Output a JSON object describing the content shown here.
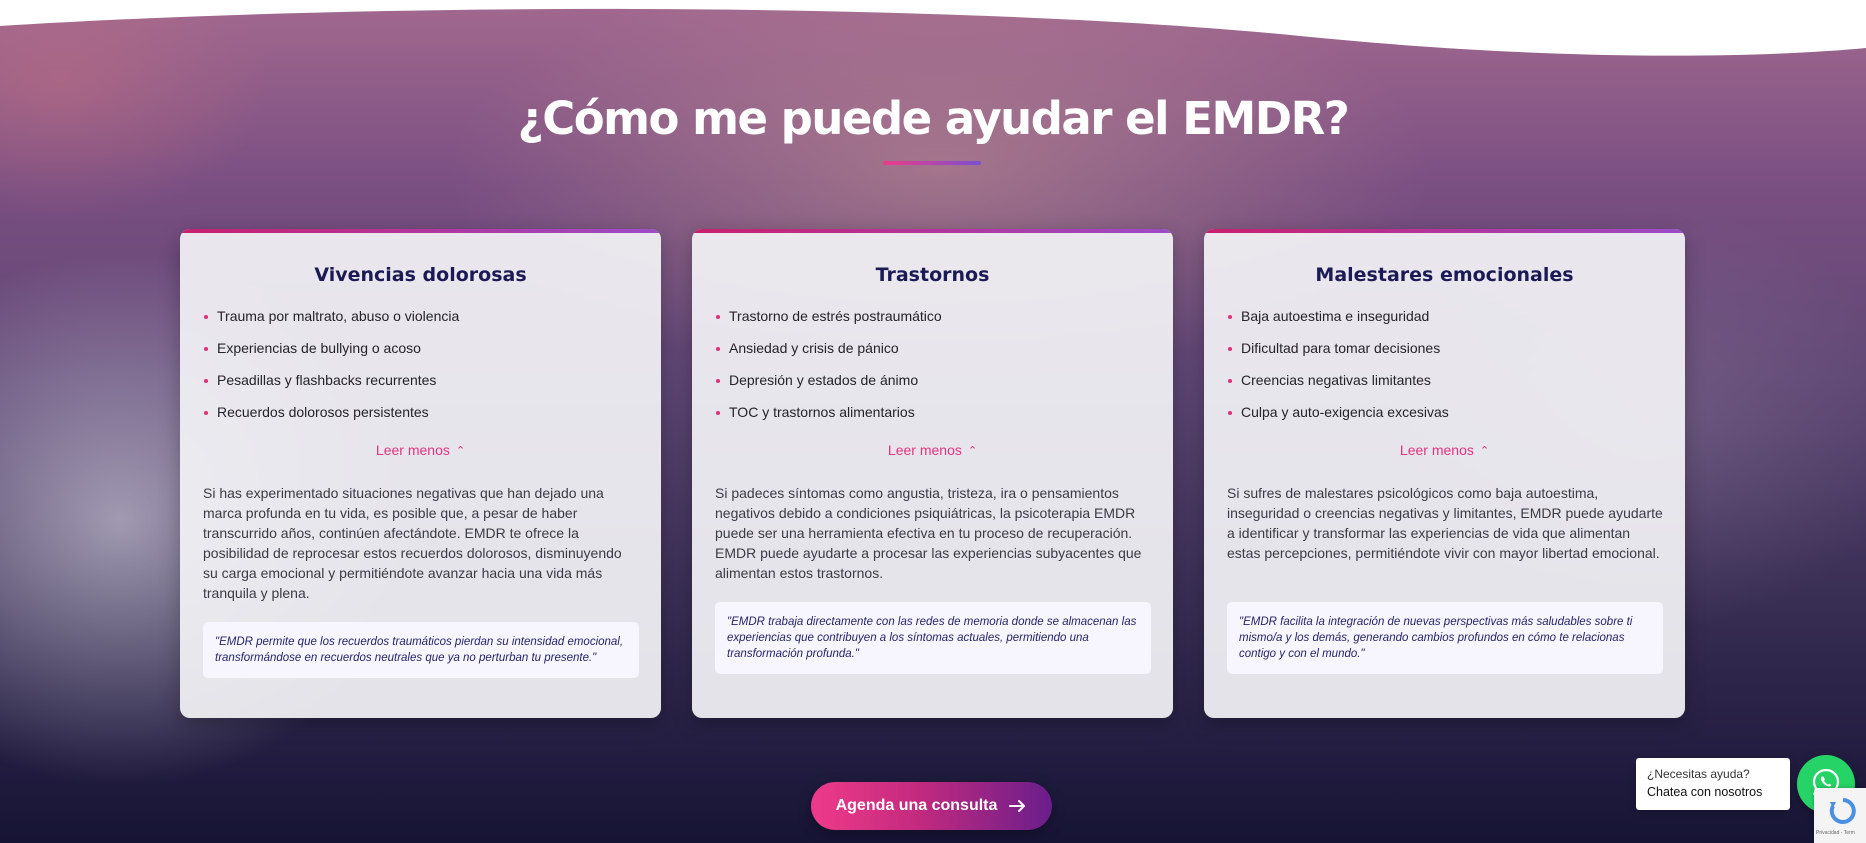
{
  "section": {
    "title": "¿Cómo me puede ayudar el EMDR?"
  },
  "cards": [
    {
      "title": "Vivencias dolorosas",
      "items": [
        "Trauma por maltrato, abuso o violencia",
        "Experiencias de bullying o acoso",
        "Pesadillas y flashbacks recurrentes",
        "Recuerdos dolorosos persistentes"
      ],
      "toggle_label": "Leer menos",
      "description": "Si has experimentado situaciones negativas que han dejado una marca profunda en tu vida, es posible que, a pesar de haber transcurrido años, continúen afectándote. EMDR te ofrece la posibilidad de reprocesar estos recuerdos dolorosos, disminuyendo su carga emocional y permitiéndote avanzar hacia una vida más tranquila y plena.",
      "quote": "\"EMDR permite que los recuerdos traumáticos pierdan su intensidad emocional, transformándose en recuerdos neutrales que ya no perturban tu presente.\""
    },
    {
      "title": "Trastornos",
      "items": [
        "Trastorno de estrés postraumático",
        "Ansiedad y crisis de pánico",
        "Depresión y estados de ánimo",
        "TOC y trastornos alimentarios"
      ],
      "toggle_label": "Leer menos",
      "description": "Si padeces síntomas como angustia, tristeza, ira o pensamientos negativos debido a condiciones psiquiátricas, la psicoterapia EMDR puede ser una herramienta efectiva en tu proceso de recuperación. EMDR puede ayudarte a procesar las experiencias subyacentes que alimentan estos trastornos.",
      "quote": "\"EMDR trabaja directamente con las redes de memoria donde se almacenan las experiencias que contribuyen a los síntomas actuales, permitiendo una transformación profunda.\""
    },
    {
      "title": "Malestares emocionales",
      "items": [
        "Baja autoestima e inseguridad",
        "Dificultad para tomar decisiones",
        "Creencias negativas limitantes",
        "Culpa y auto-exigencia excesivas"
      ],
      "toggle_label": "Leer menos",
      "description": "Si sufres de malestares psicológicos como baja autoestima, inseguridad o creencias negativas y limitantes, EMDR puede ayudarte a identificar y transformar las experiencias de vida que alimentan estas percepciones, permitiéndote vivir con mayor libertad emocional.",
      "quote": "\"EMDR facilita la integración de nuevas perspectivas más saludables sobre ti mismo/a y los demás, generando cambios profundos en cómo te relacionas contigo y con el mundo.\""
    }
  ],
  "cta": {
    "label": "Agenda una consulta",
    "icon": "arrow-right-icon"
  },
  "whatsapp": {
    "line1": "¿Necesitas ayuda?",
    "line2": "Chatea con nosotros",
    "icon": "whatsapp-icon"
  },
  "recaptcha": {
    "text": "Privacidad - Term"
  },
  "colors": {
    "accent_pink": "#e0347f",
    "heading_navy": "#1c1a55",
    "whatsapp_green": "#25d366"
  }
}
